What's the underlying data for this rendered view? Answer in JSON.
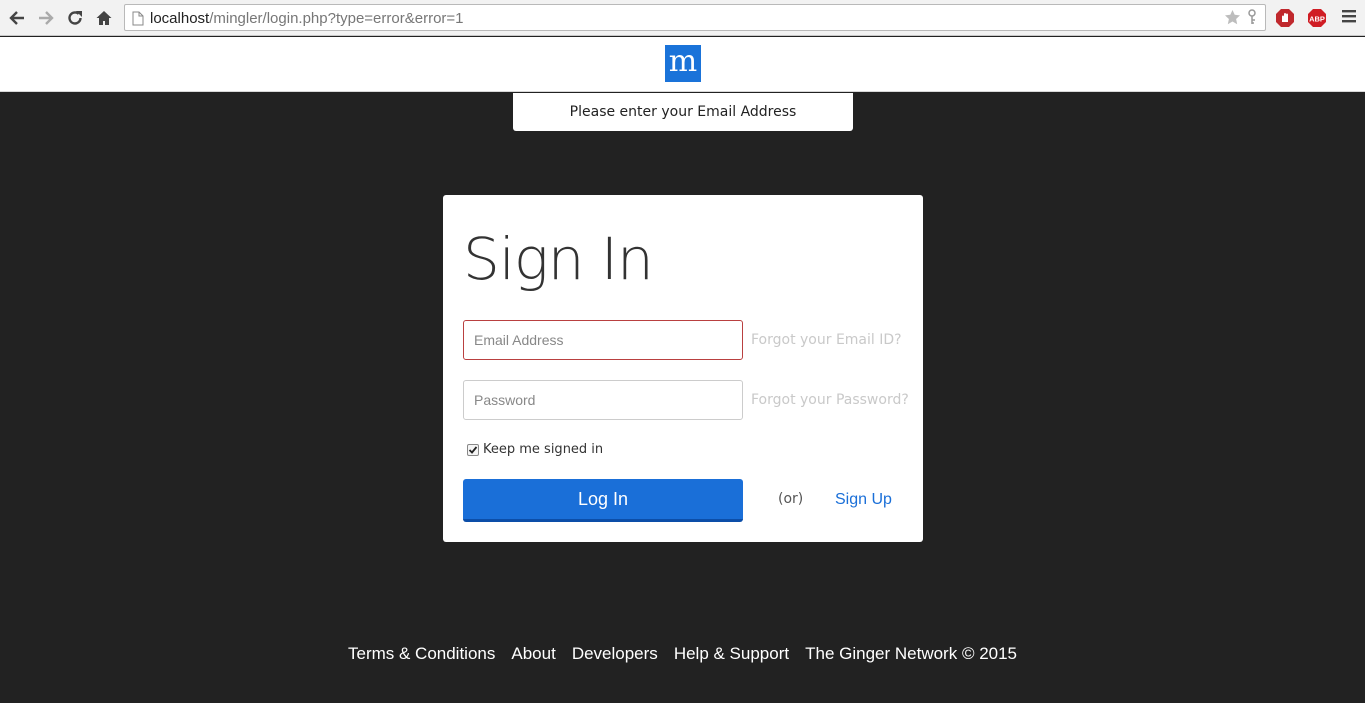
{
  "browser": {
    "url_host": "localhost",
    "url_rest": "/mingler/login.php?type=error&error=1",
    "extensions": [
      "adblock-icon",
      "abp-icon"
    ],
    "abp_label": "ABP"
  },
  "header": {
    "logo_letter": "m",
    "brand_color": "#1a73d9"
  },
  "notice": {
    "text": "Please enter your Email Address"
  },
  "signin": {
    "title": "Sign In",
    "email_placeholder": "Email Address",
    "email_value": "",
    "forgot_email": "Forgot your Email ID?",
    "password_placeholder": "Password",
    "password_value": "",
    "forgot_password": "Forgot your Password?",
    "remember_label": "Keep me signed in",
    "remember_checked": true,
    "login_label": "Log In",
    "or_label": "(or)",
    "signup_label": "Sign Up"
  },
  "footer": {
    "links": [
      "Terms & Conditions",
      "About",
      "Developers",
      "Help & Support"
    ],
    "copyright": "The Ginger Network © 2015"
  }
}
